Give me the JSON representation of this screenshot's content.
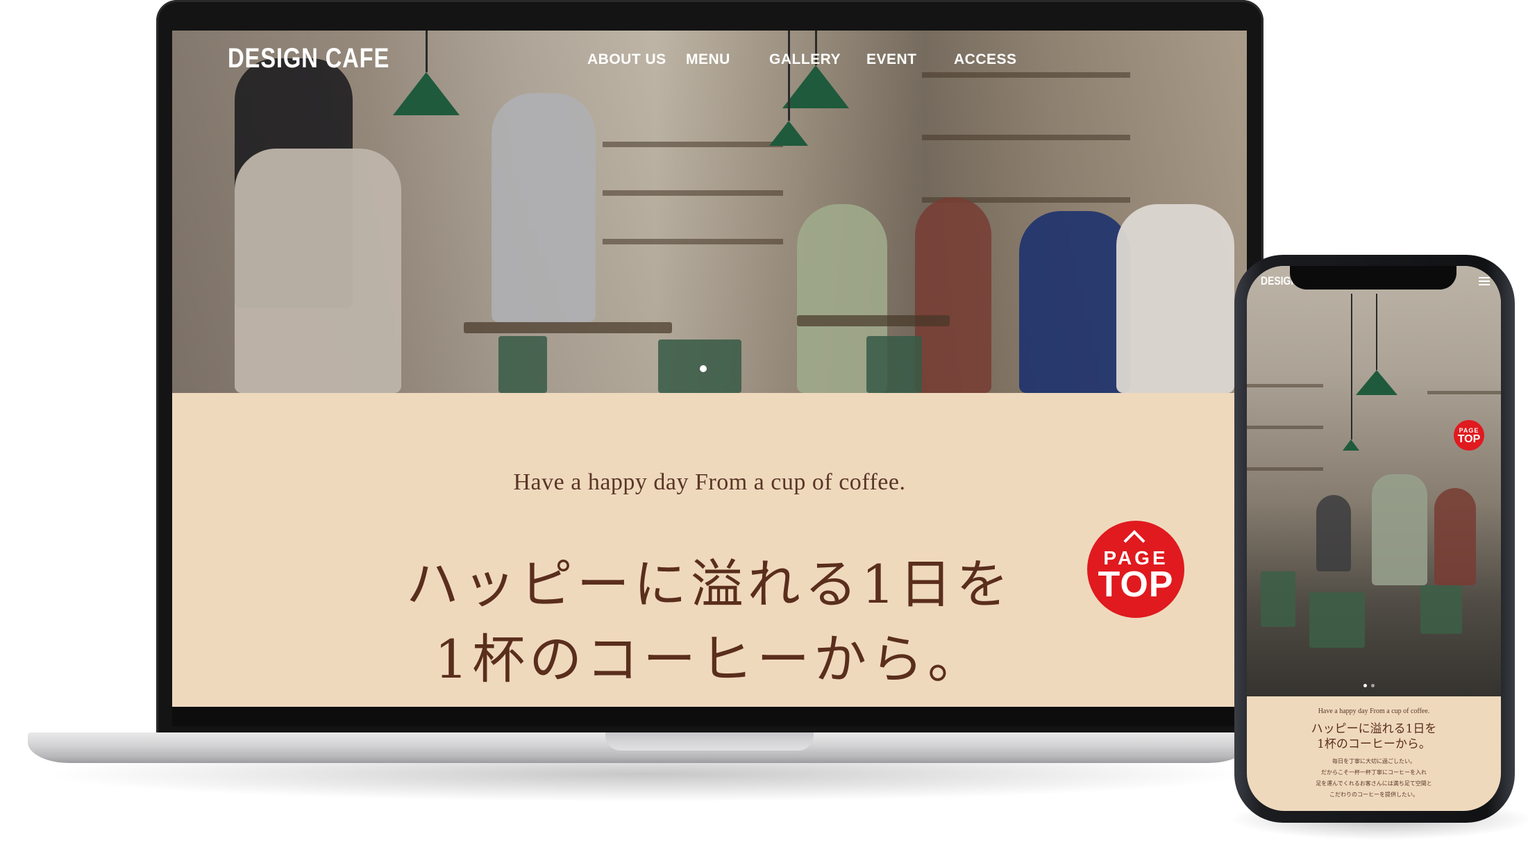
{
  "site": {
    "logo": "DESIGN CAFE",
    "nav": [
      "ABOUT US",
      "MENU",
      "GALLERY",
      "EVENT",
      "ACCESS"
    ]
  },
  "intro": {
    "tagline": "Have a happy day From a cup of coffee.",
    "headline_line1": "ハッピーに溢れる1日を",
    "headline_line2": "1杯のコーヒーから。"
  },
  "page_top": {
    "line1": "PAGE",
    "line2": "TOP"
  },
  "mobile": {
    "logo": "DESIGN C",
    "body_lines": [
      "毎日を丁寧に大切に過ごしたい。",
      "だからこそ一杯一杯丁寧にコーヒーを入れ",
      "足を運んでくれるお客さんには満ち足て空間と",
      "こだわりのコーヒーを提供したい。"
    ]
  },
  "colors": {
    "accent_red": "#e01a1f",
    "intro_bg": "#efd9bd",
    "heading_brown": "#5a2e1c"
  }
}
